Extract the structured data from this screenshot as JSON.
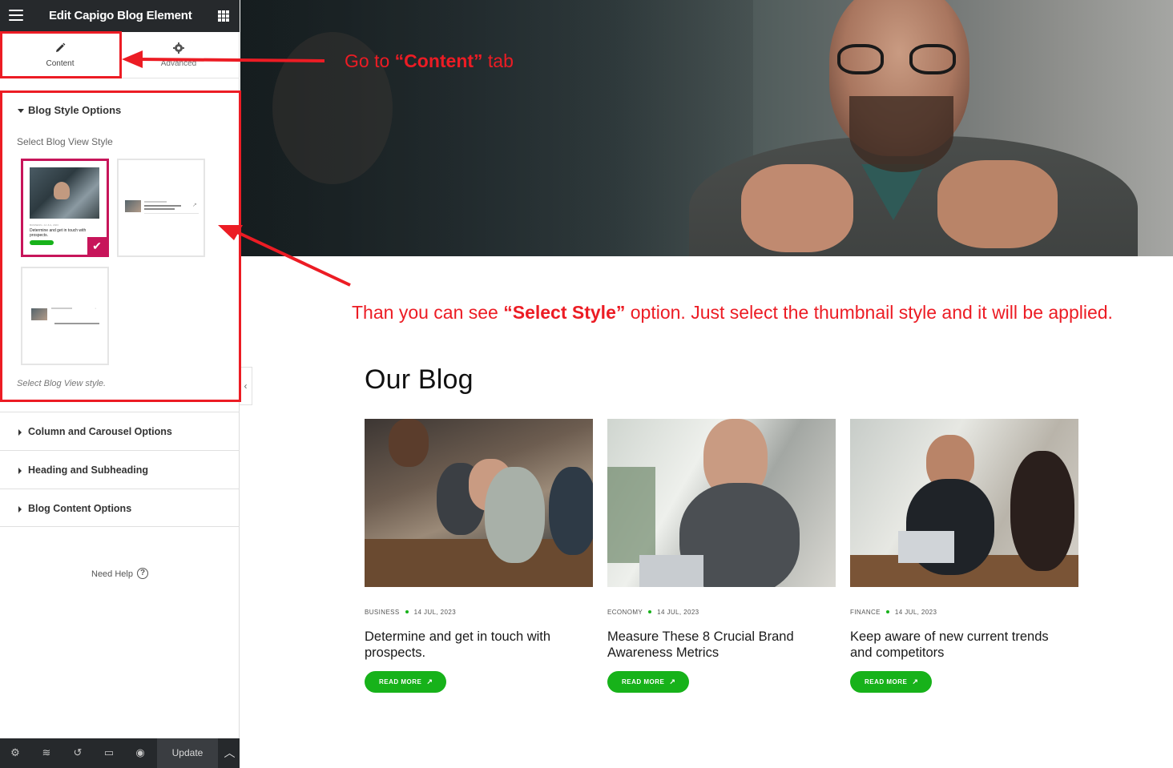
{
  "editor": {
    "title": "Edit Capigo Blog Element",
    "tabs": [
      {
        "label": "Content",
        "icon": "pencil-icon"
      },
      {
        "label": "Advanced",
        "icon": "gear-icon"
      }
    ],
    "blog_style_section": {
      "title": "Blog Style Options",
      "field_label": "Select Blog View Style",
      "help_text": "Select Blog View style.",
      "thumbnails": [
        {
          "name": "style-1",
          "selected": true
        },
        {
          "name": "style-2",
          "selected": false
        },
        {
          "name": "style-3",
          "selected": false
        }
      ],
      "selected_color": "#c7155a"
    },
    "accordions": [
      {
        "label": "Column and Carousel Options"
      },
      {
        "label": "Heading and Subheading"
      },
      {
        "label": "Blog Content Options"
      }
    ],
    "need_help": "Need Help",
    "footer": {
      "icons": [
        "settings-icon",
        "layers-icon",
        "history-icon",
        "responsive-icon",
        "preview-eye-icon"
      ],
      "update_label": "Update"
    }
  },
  "annotations": {
    "step1": {
      "prefix": "Go  to ",
      "highlight": "“Content”",
      "suffix": " tab"
    },
    "step2": {
      "prefix": "Than you can see ",
      "highlight": "“Select Style”",
      "suffix": " option. Just select the thumbnail style and it will be applied."
    },
    "color": "#ec1c24"
  },
  "blog": {
    "heading": "Our Blog",
    "accent_color": "#17b21a",
    "posts": [
      {
        "category": "BUSINESS",
        "date": "14 JUL, 2023",
        "title": "Determine and get in touch with prospects.",
        "button": "READ MORE"
      },
      {
        "category": "ECONOMY",
        "date": "14 JUL, 2023",
        "title": "Measure These 8 Crucial Brand Awareness Metrics",
        "button": "READ MORE"
      },
      {
        "category": "FINANCE",
        "date": "14 JUL, 2023",
        "title": "Keep aware of new current trends and competitors",
        "button": "READ MORE"
      }
    ]
  },
  "thumbnail_preview": {
    "meta": "BUSINESS • 14 JUL, 2023",
    "title": "Determine and get in touch with prospects."
  }
}
